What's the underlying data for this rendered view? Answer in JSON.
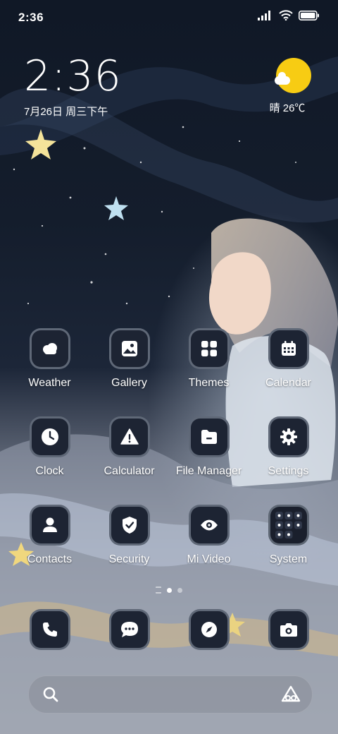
{
  "status_bar": {
    "time": "2:36"
  },
  "lock_clock": {
    "time": "2:36",
    "date": "7月26日 周三下午"
  },
  "weather_widget": {
    "text": "晴 26℃",
    "sun_color": "#f7cc13"
  },
  "apps": [
    {
      "label": "Weather",
      "icon": "weather-icon"
    },
    {
      "label": "Gallery",
      "icon": "gallery-icon"
    },
    {
      "label": "Themes",
      "icon": "themes-icon"
    },
    {
      "label": "Calendar",
      "icon": "calendar-icon"
    },
    {
      "label": "Clock",
      "icon": "clock-icon"
    },
    {
      "label": "Calculator",
      "icon": "calculator-icon"
    },
    {
      "label": "File Manager",
      "icon": "file-manager-icon"
    },
    {
      "label": "Settings",
      "icon": "settings-icon"
    },
    {
      "label": "Contacts",
      "icon": "contacts-icon"
    },
    {
      "label": "Security",
      "icon": "security-icon"
    },
    {
      "label": "Mi Video",
      "icon": "mi-video-icon"
    },
    {
      "label": "System",
      "icon": "system-folder-icon"
    }
  ],
  "dock": [
    {
      "icon": "phone-icon"
    },
    {
      "icon": "messages-icon"
    },
    {
      "icon": "browser-icon"
    },
    {
      "icon": "camera-icon"
    }
  ],
  "page_indicator": {
    "pages": 2,
    "active": 1
  },
  "search_bar": {
    "left_icon": "search-icon",
    "right_icon": "assistant-icon"
  }
}
